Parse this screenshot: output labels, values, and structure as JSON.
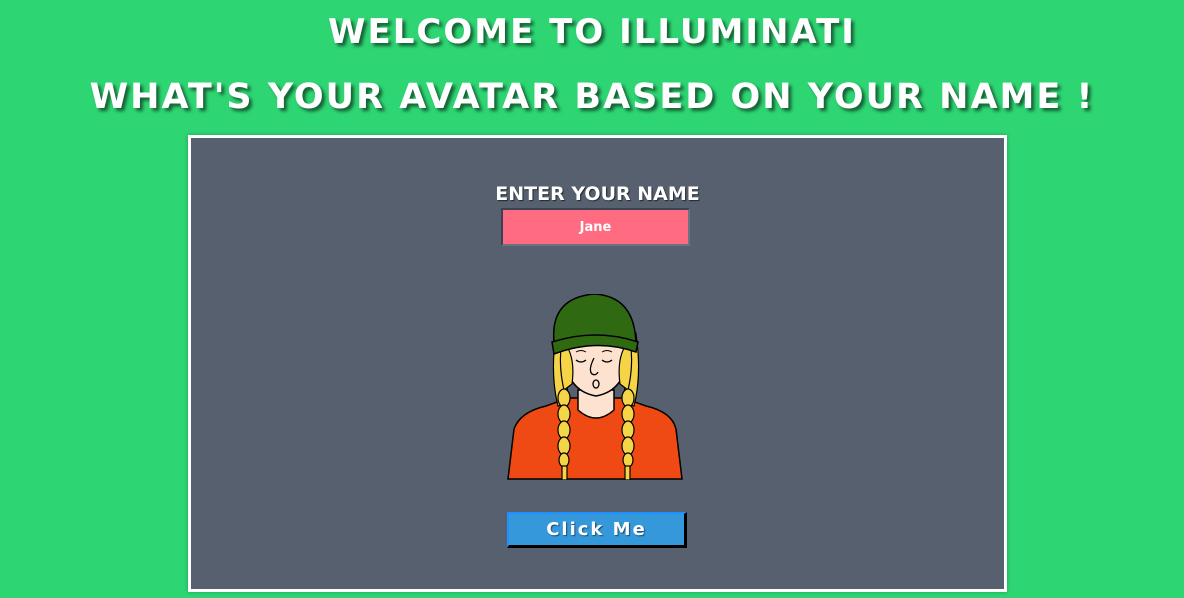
{
  "header": {
    "title": "WELCOME TO ILLUMINATI",
    "subtitle": "WHAT'S YOUR AVATAR BASED ON YOUR NAME !"
  },
  "form": {
    "label": "ENTER YOUR NAME",
    "name_value": "Jane"
  },
  "avatar": {
    "icon": "avatar-illustration",
    "hat_color": "#2f6a12",
    "hair_color": "#f5d547",
    "shirt_color": "#f04a14",
    "skin_color": "#fde2cf"
  },
  "button": {
    "label": "Click Me"
  },
  "colors": {
    "background": "#2ed573",
    "panel": "#57606f",
    "input": "#ff6b81",
    "button": "#3498db"
  }
}
